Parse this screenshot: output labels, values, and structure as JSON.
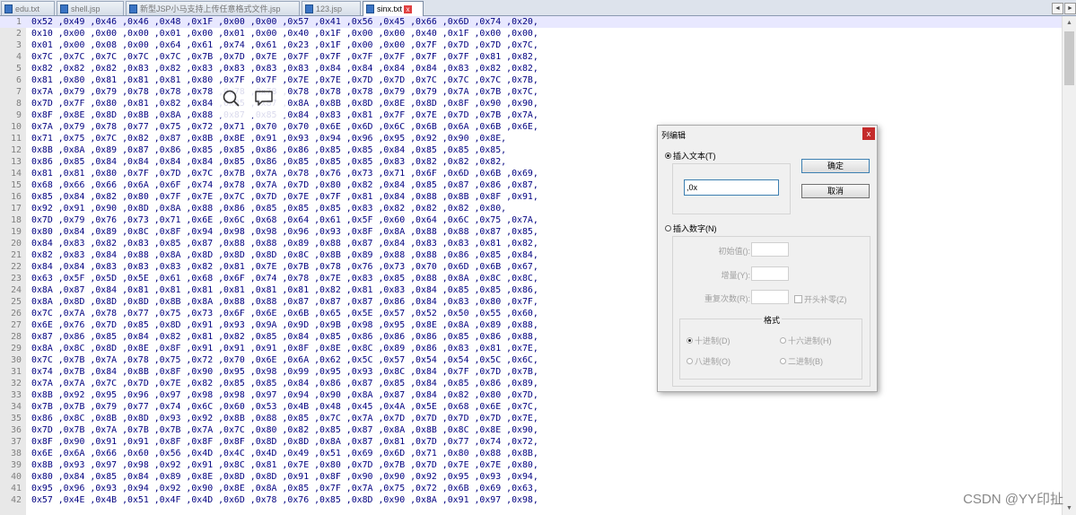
{
  "tabs": [
    {
      "label": "edu.txt",
      "active": false
    },
    {
      "label": "shell.jsp",
      "active": false
    },
    {
      "label": "新型JSP小马支持上传任意格式文件.jsp",
      "active": false
    },
    {
      "label": "123.jsp",
      "active": false
    },
    {
      "label": "sinx.txt",
      "active": true
    }
  ],
  "tab_nav": {
    "left": "◄",
    "right": "►"
  },
  "editor": {
    "lines": [
      "0x52 ,0x49 ,0x46 ,0x46 ,0x48 ,0x1F ,0x00 ,0x00 ,0x57 ,0x41 ,0x56 ,0x45 ,0x66 ,0x6D ,0x74 ,0x20,",
      "0x10 ,0x00 ,0x00 ,0x00 ,0x01 ,0x00 ,0x01 ,0x00 ,0x40 ,0x1F ,0x00 ,0x00 ,0x40 ,0x1F ,0x00 ,0x00,",
      "0x01 ,0x00 ,0x08 ,0x00 ,0x64 ,0x61 ,0x74 ,0x61 ,0x23 ,0x1F ,0x00 ,0x00 ,0x7F ,0x7D ,0x7D ,0x7C,",
      "0x7C ,0x7C ,0x7C ,0x7C ,0x7C ,0x7B ,0x7D ,0x7E ,0x7F ,0x7F ,0x7F ,0x7F ,0x7F ,0x7F ,0x81 ,0x82,",
      "0x82 ,0x82 ,0x82 ,0x83 ,0x82 ,0x83 ,0x83 ,0x83 ,0x83 ,0x84 ,0x84 ,0x84 ,0x84 ,0x83 ,0x82 ,0x82,",
      "0x81 ,0x80 ,0x81 ,0x81 ,0x81 ,0x80 ,0x7F ,0x7F ,0x7E ,0x7E ,0x7D ,0x7D ,0x7C ,0x7C ,0x7C ,0x7B,",
      "0x7A ,0x79 ,0x79 ,0x78 ,0x78 ,0x78 ,0x78 ,0x78 ,0x78 ,0x78 ,0x78 ,0x79 ,0x79 ,0x7A ,0x7B ,0x7C,",
      "0x7D ,0x7F ,0x80 ,0x81 ,0x82 ,0x84 ,0x85 ,0x87 ,0x8A ,0x8B ,0x8D ,0x8E ,0x8D ,0x8F ,0x90 ,0x90,",
      "0x8F ,0x8E ,0x8D ,0x8B ,0x8A ,0x88 ,0x87 ,0x85 ,0x84 ,0x83 ,0x81 ,0x7F ,0x7E ,0x7D ,0x7B ,0x7A,",
      "0x7A ,0x79 ,0x78 ,0x77 ,0x75 ,0x72 ,0x71 ,0x70 ,0x70 ,0x6E ,0x6D ,0x6C ,0x6B ,0x6A ,0x6B ,0x6E,",
      "0x71 ,0x75 ,0x7C ,0x82 ,0x87 ,0x8B ,0x8E ,0x91 ,0x93 ,0x94 ,0x96 ,0x95 ,0x92 ,0x90 ,0x8E,",
      "0x8B ,0x8A ,0x89 ,0x87 ,0x86 ,0x85 ,0x85 ,0x86 ,0x86 ,0x85 ,0x85 ,0x84 ,0x85 ,0x85 ,0x85,",
      "0x86 ,0x85 ,0x84 ,0x84 ,0x84 ,0x84 ,0x85 ,0x86 ,0x85 ,0x85 ,0x85 ,0x83 ,0x82 ,0x82 ,0x82,",
      "0x81 ,0x81 ,0x80 ,0x7F ,0x7D ,0x7C ,0x7B ,0x7A ,0x78 ,0x76 ,0x73 ,0x71 ,0x6F ,0x6D ,0x6B ,0x69,",
      "0x68 ,0x66 ,0x66 ,0x6A ,0x6F ,0x74 ,0x78 ,0x7A ,0x7D ,0x80 ,0x82 ,0x84 ,0x85 ,0x87 ,0x86 ,0x87,",
      "0x85 ,0x84 ,0x82 ,0x80 ,0x7F ,0x7E ,0x7C ,0x7D ,0x7E ,0x7F ,0x81 ,0x84 ,0x88 ,0x8B ,0x8F ,0x91,",
      "0x92 ,0x91 ,0x90 ,0x8D ,0x8A ,0x88 ,0x86 ,0x85 ,0x85 ,0x85 ,0x83 ,0x82 ,0x82 ,0x82 ,0x80,",
      "0x7D ,0x79 ,0x76 ,0x73 ,0x71 ,0x6E ,0x6C ,0x68 ,0x64 ,0x61 ,0x5F ,0x60 ,0x64 ,0x6C ,0x75 ,0x7A,",
      "0x80 ,0x84 ,0x89 ,0x8C ,0x8F ,0x94 ,0x98 ,0x98 ,0x96 ,0x93 ,0x8F ,0x8A ,0x88 ,0x88 ,0x87 ,0x85,",
      "0x84 ,0x83 ,0x82 ,0x83 ,0x85 ,0x87 ,0x88 ,0x88 ,0x89 ,0x88 ,0x87 ,0x84 ,0x83 ,0x83 ,0x81 ,0x82,",
      "0x82 ,0x83 ,0x84 ,0x88 ,0x8A ,0x8D ,0x8D ,0x8D ,0x8C ,0x8B ,0x89 ,0x88 ,0x88 ,0x86 ,0x85 ,0x84,",
      "0x84 ,0x84 ,0x83 ,0x83 ,0x83 ,0x82 ,0x81 ,0x7E ,0x7B ,0x78 ,0x76 ,0x73 ,0x70 ,0x6D ,0x6B ,0x67,",
      "0x63 ,0x5F ,0x5D ,0x5E ,0x61 ,0x68 ,0x6F ,0x74 ,0x78 ,0x7E ,0x83 ,0x85 ,0x88 ,0x8A ,0x8C ,0x8C,",
      "0x8A ,0x87 ,0x84 ,0x81 ,0x81 ,0x81 ,0x81 ,0x81 ,0x81 ,0x82 ,0x81 ,0x83 ,0x84 ,0x85 ,0x85 ,0x86,",
      "0x8A ,0x8D ,0x8D ,0x8D ,0x8B ,0x8A ,0x88 ,0x88 ,0x87 ,0x87 ,0x87 ,0x86 ,0x84 ,0x83 ,0x80 ,0x7F,",
      "0x7C ,0x7A ,0x78 ,0x77 ,0x75 ,0x73 ,0x6F ,0x6E ,0x6B ,0x65 ,0x5E ,0x57 ,0x52 ,0x50 ,0x55 ,0x60,",
      "0x6E ,0x76 ,0x7D ,0x85 ,0x8D ,0x91 ,0x93 ,0x9A ,0x9D ,0x9B ,0x98 ,0x95 ,0x8E ,0x8A ,0x89 ,0x88,",
      "0x87 ,0x86 ,0x85 ,0x84 ,0x82 ,0x81 ,0x82 ,0x85 ,0x84 ,0x85 ,0x86 ,0x86 ,0x86 ,0x85 ,0x86 ,0x88,",
      "0x8A ,0x8C ,0x8D ,0x8E ,0x8F ,0x91 ,0x91 ,0x91 ,0x8F ,0x8E ,0x8C ,0x89 ,0x86 ,0x83 ,0x81 ,0x7E,",
      "0x7C ,0x7B ,0x7A ,0x78 ,0x75 ,0x72 ,0x70 ,0x6E ,0x6A ,0x62 ,0x5C ,0x57 ,0x54 ,0x54 ,0x5C ,0x6C,",
      "0x74 ,0x7B ,0x84 ,0x8B ,0x8F ,0x90 ,0x95 ,0x98 ,0x99 ,0x95 ,0x93 ,0x8C ,0x84 ,0x7F ,0x7D ,0x7B,",
      "0x7A ,0x7A ,0x7C ,0x7D ,0x7E ,0x82 ,0x85 ,0x85 ,0x84 ,0x86 ,0x87 ,0x85 ,0x84 ,0x85 ,0x86 ,0x89,",
      "0x8B ,0x92 ,0x95 ,0x96 ,0x97 ,0x98 ,0x98 ,0x97 ,0x94 ,0x90 ,0x8A ,0x87 ,0x84 ,0x82 ,0x80 ,0x7D,",
      "0x7B ,0x7B ,0x79 ,0x77 ,0x74 ,0x6C ,0x60 ,0x53 ,0x4B ,0x48 ,0x45 ,0x4A ,0x5E ,0x68 ,0x6E ,0x7C,",
      "0x86 ,0x8C ,0x8B ,0x8D ,0x93 ,0x92 ,0x8B ,0x88 ,0x85 ,0x7C ,0x7A ,0x7D ,0x7D ,0x7D ,0x7D ,0x7E,",
      "0x7D ,0x7B ,0x7A ,0x7B ,0x7B ,0x7A ,0x7C ,0x80 ,0x82 ,0x85 ,0x87 ,0x8A ,0x8B ,0x8C ,0x8E ,0x90,",
      "0x8F ,0x90 ,0x91 ,0x91 ,0x8F ,0x8F ,0x8F ,0x8D ,0x8D ,0x8A ,0x87 ,0x81 ,0x7D ,0x77 ,0x74 ,0x72,",
      "0x6E ,0x6A ,0x66 ,0x60 ,0x56 ,0x4D ,0x4C ,0x4D ,0x49 ,0x51 ,0x69 ,0x6D ,0x71 ,0x80 ,0x88 ,0x8B,",
      "0x8B ,0x93 ,0x97 ,0x98 ,0x92 ,0x91 ,0x8C ,0x81 ,0x7E ,0x80 ,0x7D ,0x7B ,0x7D ,0x7E ,0x7E ,0x80,",
      "0x80 ,0x84 ,0x85 ,0x84 ,0x89 ,0x8E ,0x8D ,0x8D ,0x91 ,0x8F ,0x90 ,0x90 ,0x92 ,0x95 ,0x93 ,0x94,",
      "0x95 ,0x96 ,0x93 ,0x94 ,0x92 ,0x90 ,0x8E ,0x8A ,0x85 ,0x7F ,0x7A ,0x75 ,0x72 ,0x6B ,0x69 ,0x63,",
      "0x57 ,0x4E ,0x4B ,0x51 ,0x4F ,0x4D ,0x6D ,0x78 ,0x76 ,0x85 ,0x8D ,0x90 ,0x8A ,0x91 ,0x97 ,0x98,"
    ]
  },
  "scrollbar": {
    "up": "▲",
    "down": "▼"
  },
  "dialog": {
    "title": "列编辑",
    "close": "x",
    "insert_text_label": "插入文本(T)",
    "text_value": ",0x",
    "ok_label": "确定",
    "cancel_label": "取消",
    "insert_number_label": "插入数字(N)",
    "initial_label": "初始值():",
    "increment_label": "增量(Y):",
    "repeat_label": "重复次数(R):",
    "leading_zero_label": "开头补零(Z)",
    "format_title": "格式",
    "formats": {
      "dec": "十进制(D)",
      "hex": "十六进制(H)",
      "oct": "八进制(O)",
      "bin": "二进制(B)"
    }
  },
  "watermark": "CSDN @YY印扯"
}
